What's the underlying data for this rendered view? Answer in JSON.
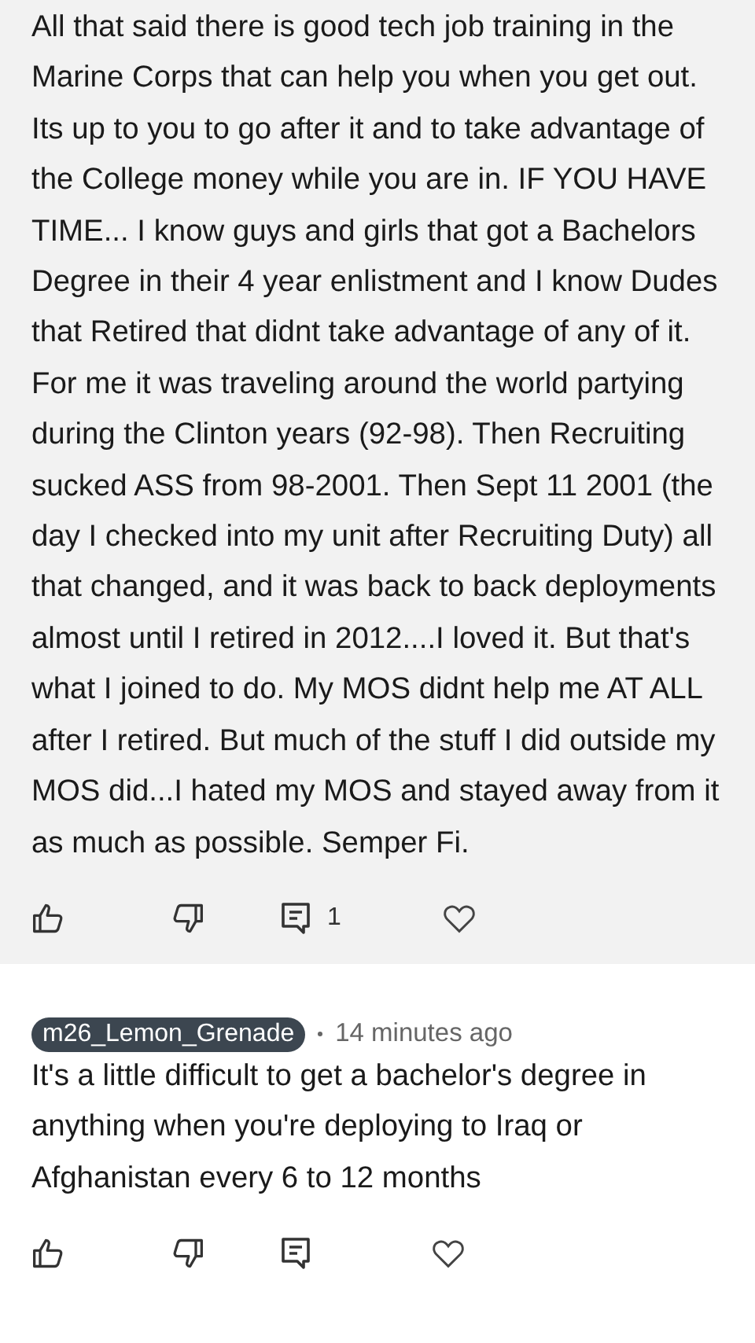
{
  "comments": [
    {
      "highlighted": true,
      "paragraphs": [
        "All that said there is good tech job training in the Marine Corps that can help you when you get out. Its up to you to go after it and to take advantage of the College money while you are in. IF YOU HAVE TIME... I know guys and girls that got a Bachelors Degree in their 4 year enlistment and I know Dudes that Retired that didnt take advantage of any of it.",
        "For me it was traveling around the world partying during the Clinton years (92-98). Then Recruiting sucked ASS from 98-2001. Then Sept 11 2001 (the day I checked into my unit after Recruiting Duty)  all that changed, and it was back to back deployments almost until I retired in 2012....I loved it. But that's what I joined to do. My MOS didnt help me AT ALL after I retired. But much of the stuff I did outside my MOS did...I hated my MOS and stayed away from it as much as possible.  Semper Fi."
      ],
      "reply_count": "1"
    },
    {
      "highlighted": false,
      "author": "m26_Lemon_Grenade",
      "time": "14 minutes ago",
      "paragraphs": [
        "It's a little difficult to get a bachelor's degree in anything when you're deploying to Iraq or Afghanistan every 6 to 12 months"
      ]
    }
  ]
}
